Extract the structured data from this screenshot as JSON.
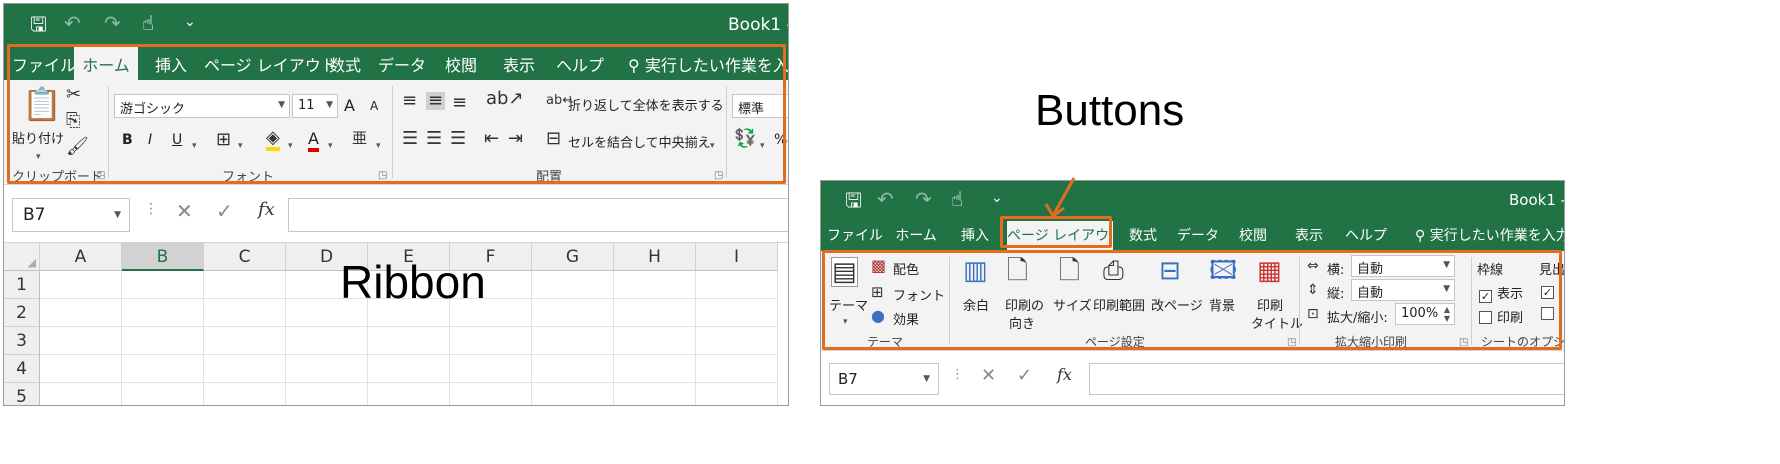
{
  "labels": {
    "ribbon": "Ribbon",
    "buttons": "Buttons"
  },
  "colors": {
    "title_green": "#217346",
    "highlight_orange": "#e36c1e",
    "ribbon_bg": "#f3f3f3"
  },
  "left": {
    "book_title": "Book1  -",
    "tabs": [
      "ファイル",
      "ホーム",
      "挿入",
      "ページ レイアウト",
      "数式",
      "データ",
      "校閲",
      "表示",
      "ヘルプ"
    ],
    "active_tab": "ホーム",
    "tell_me": "実行したい作業を入力し",
    "clipboard": {
      "paste": "貼り付け",
      "group": "クリップボード"
    },
    "font": {
      "name": "游ゴシック",
      "size": "11",
      "bold": "B",
      "italic": "I",
      "underline": "U",
      "grow": "A",
      "shrink": "A",
      "font_color": "A",
      "group": "フォント"
    },
    "alignment": {
      "wrap": "折り返して全体を表示する",
      "merge": "セルを結合して中央揃え",
      "group": "配置"
    },
    "number": {
      "format": "標準",
      "percent": "%"
    },
    "namebox": "B7",
    "fx": "fx",
    "columns": [
      "A",
      "B",
      "C",
      "D",
      "E",
      "F",
      "G",
      "H",
      "I"
    ],
    "rows": [
      "1",
      "2",
      "3",
      "4",
      "5"
    ],
    "selected_column": "B"
  },
  "right": {
    "book_title": "Book1  -",
    "tabs": [
      "ファイル",
      "ホーム",
      "挿入",
      "ページ レイアウト",
      "数式",
      "データ",
      "校閲",
      "表示",
      "ヘルプ"
    ],
    "active_tab": "ページ レイアウト",
    "tell_me": "実行したい作業を入力し",
    "themes": {
      "theme": "テーマ",
      "colors": "配色",
      "fonts": "フォント",
      "effects": "効果",
      "group": "テーマ"
    },
    "page_setup": {
      "margins": "余白",
      "orientation_1": "印刷の",
      "orientation_2": "向き",
      "size": "サイズ",
      "print_area": "印刷範囲",
      "breaks": "改ページ",
      "background": "背景",
      "titles_1": "印刷",
      "titles_2": "タイトル",
      "group": "ページ設定"
    },
    "scale": {
      "width_label": "横:",
      "width_value": "自動",
      "height_label": "縦:",
      "height_value": "自動",
      "scale_label": "拡大/縮小:",
      "scale_value": "100%",
      "group": "拡大縮小印刷"
    },
    "sheet_options": {
      "gridlines": "枠線",
      "view": "表示",
      "print": "印刷",
      "headings": "見出",
      "group": "シートのオプション"
    },
    "namebox": "B7",
    "fx": "fx"
  }
}
